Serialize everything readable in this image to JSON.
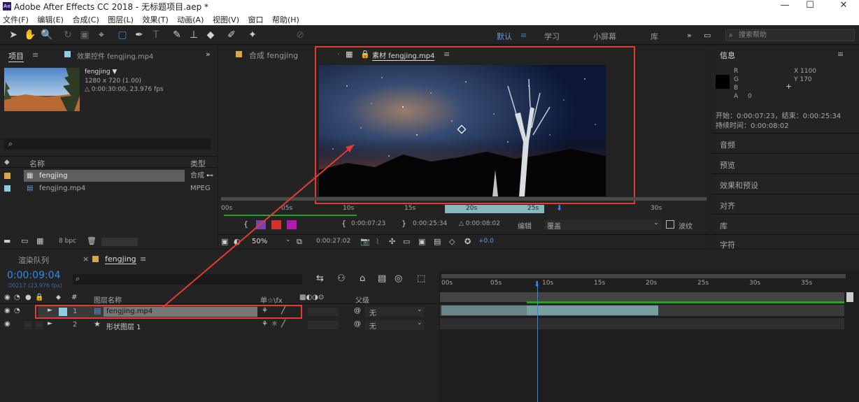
{
  "window": {
    "title": "Adobe After Effects CC 2018 - 无标题项目.aep *",
    "logo": "Ae"
  },
  "menu": [
    "文件(F)",
    "编辑(E)",
    "合成(C)",
    "图层(L)",
    "效果(T)",
    "动画(A)",
    "视图(V)",
    "窗口",
    "帮助(H)"
  ],
  "workspaces": {
    "default": "默认",
    "learn": "学习",
    "small": "小屏幕",
    "library": "库",
    "more": "»"
  },
  "search": {
    "placeholder": "搜索帮助"
  },
  "project": {
    "tab": "项目",
    "effects_tab": "效果控件 fengjing.mp4",
    "item_name": "fengjing ▼",
    "item_info1": "1280 x 720 (1.00)",
    "item_info2": "△ 0:00:30:00, 23.976 fps",
    "col_name": "名称",
    "col_type": "类型",
    "items": [
      {
        "name": "fengjing",
        "type": "合成",
        "color": "#d8a64c"
      },
      {
        "name": "fengjing.mp4",
        "type": "MPEG",
        "color": "#8fcbe4"
      }
    ],
    "bpc": "8 bpc"
  },
  "comp_tab": "合成 fengjing",
  "footage_tab": "素材 fengjing.mp4",
  "viewer": {
    "ruler": [
      "00s",
      "05s",
      "10s",
      "15s",
      "20s",
      "25s",
      "30s"
    ],
    "in_time": "0:00:07:23",
    "out_time": "0:00:25:34",
    "dur_time": "△ 0:00:08:02",
    "edit_label": "编辑",
    "edit_target": "覆盖",
    "ripple_label": "波纹",
    "zoom": "50%",
    "current_time": "0:00:27:02",
    "exposure": "+0.0"
  },
  "info": {
    "title": "信息",
    "r": "R",
    "g": "G",
    "b": "B",
    "a": "A",
    "a_val": "0",
    "x": "X 1100",
    "y": "Y 170",
    "start": "开始：0:00:07:23，结束：0:00:25:34",
    "duration": "持续时间：0:00:08:02",
    "panels": [
      "音频",
      "预览",
      "效果和预设",
      "对齐",
      "库",
      "字符"
    ]
  },
  "timeline": {
    "render_tab": "渲染队列",
    "comp_tab": "fengjing",
    "current_time": "0:00:09:04",
    "current_frames": "00217 (23.976 fps)",
    "col_name": "图层名称",
    "col_switches": "单☆\\fx",
    "col_parent": "父级",
    "ruler": [
      "00s",
      "05s",
      "10s",
      "15s",
      "20s",
      "25s",
      "30s",
      "35s"
    ],
    "layers": [
      {
        "num": "1",
        "name": "fengjing.mp4",
        "parent": "无"
      },
      {
        "num": "2",
        "name": "形状图层 1",
        "parent": "无"
      }
    ]
  },
  "colors": {
    "accent": "#2d8ceb",
    "highlight_box": "#e33c32",
    "work_area": "#1fa81f",
    "clip": "#87b8bd"
  }
}
